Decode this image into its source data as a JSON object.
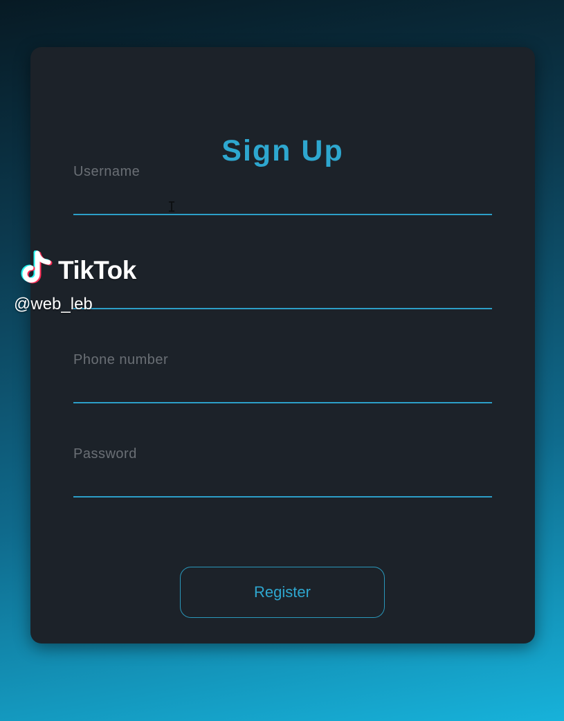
{
  "form": {
    "title": "Sign Up",
    "fields": [
      {
        "label": "Username",
        "value": ""
      },
      {
        "label": "",
        "value": ""
      },
      {
        "label": "Phone number",
        "value": ""
      },
      {
        "label": "Password",
        "value": ""
      }
    ],
    "register_label": "Register"
  },
  "watermark": {
    "brand": "TikTok",
    "handle": "@web_leb",
    "icon": "tiktok-logo-icon"
  },
  "colors": {
    "accent": "#2ea7cf",
    "card": "#1c2229",
    "label": "#6a6f75"
  }
}
